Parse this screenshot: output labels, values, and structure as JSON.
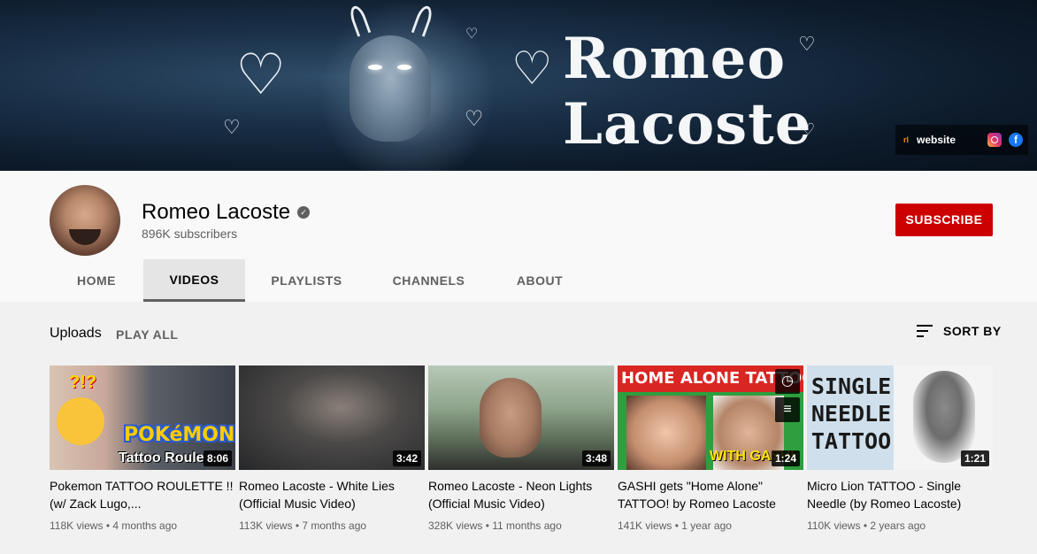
{
  "banner": {
    "title_line1": "Romeo",
    "title_line2": "Lacoste",
    "links": {
      "website_label": "website",
      "website_favicon": "rl",
      "instagram_icon": "instagram-icon",
      "facebook_icon": "facebook-icon"
    }
  },
  "channel": {
    "name": "Romeo Lacoste",
    "verified_glyph": "✓",
    "subscribers": "896K subscribers",
    "subscribe_label": "SUBSCRIBE"
  },
  "tabs": [
    {
      "label": "HOME",
      "active": false
    },
    {
      "label": "VIDEOS",
      "active": true
    },
    {
      "label": "PLAYLISTS",
      "active": false
    },
    {
      "label": "CHANNELS",
      "active": false
    },
    {
      "label": "ABOUT",
      "active": false
    }
  ],
  "section": {
    "title": "Uploads",
    "play_all": "PLAY ALL",
    "sort_by": "SORT BY"
  },
  "videos": [
    {
      "title": "Pokemon TATTOO ROULETTE !! (w/ Zack Lugo,...",
      "duration": "8:06",
      "views": "118K views",
      "age": "4 months ago",
      "thumb_text": {
        "top": "?!?",
        "main": "POKéMON",
        "sub": "Tattoo Roule"
      }
    },
    {
      "title": "Romeo Lacoste - White Lies (Official Music Video)",
      "duration": "3:42",
      "views": "113K views",
      "age": "7 months ago"
    },
    {
      "title": "Romeo Lacoste - Neon Lights (Official Music Video)",
      "duration": "3:48",
      "views": "328K views",
      "age": "11 months ago"
    },
    {
      "title": "GASHI gets \"Home Alone\" TATTOO! by Romeo Lacoste",
      "duration": "1:24",
      "views": "141K views",
      "age": "1 year ago",
      "thumb_text": {
        "banner": "HOME ALONE TATTOO",
        "with": "WITH GASHI"
      },
      "hover_icons": {
        "watch_later": "clock-icon",
        "add_to_queue": "queue-icon"
      }
    },
    {
      "title": "Micro Lion TATTOO - Single Needle (by Romeo Lacoste)",
      "duration": "1:21",
      "views": "110K views",
      "age": "2 years ago",
      "thumb_text": {
        "words": "SINGLE NEEDLE TATTOO"
      }
    }
  ],
  "colors": {
    "subscribe_bg": "#cc0000",
    "page_bg": "#f9f9f9",
    "content_bg": "#f1f1f1",
    "meta_text": "#606060"
  }
}
